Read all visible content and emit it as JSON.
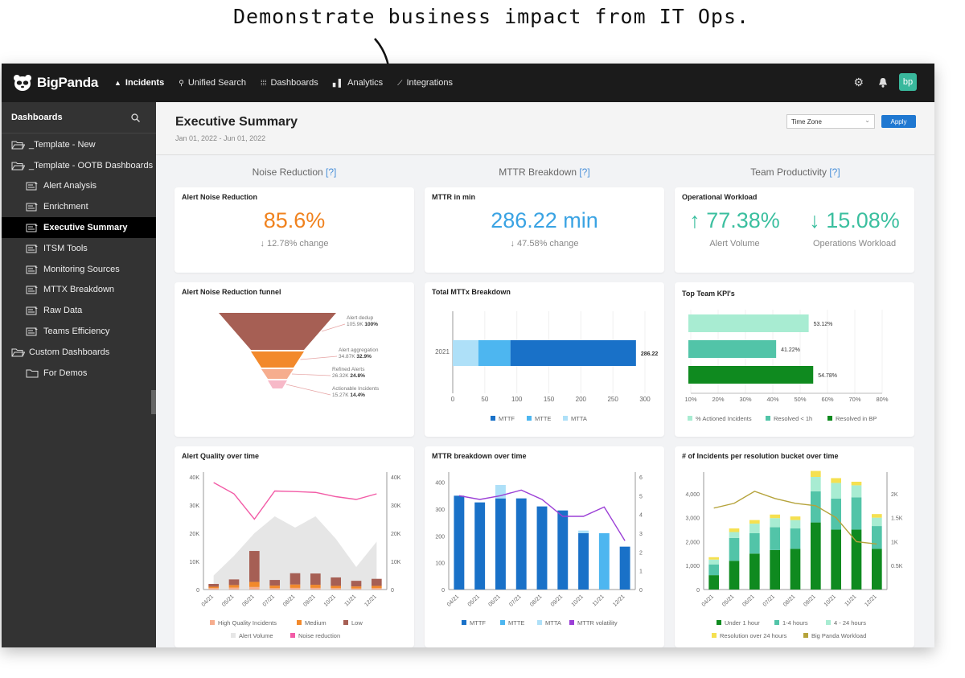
{
  "caption": "Demonstrate business impact from IT Ops.",
  "app": {
    "brand": "BigPanda",
    "nav": [
      {
        "label": "Incidents",
        "icon": "alert-triangle-icon",
        "active": true
      },
      {
        "label": "Unified Search",
        "icon": "search-icon",
        "active": false
      },
      {
        "label": "Dashboards",
        "icon": "grid-icon",
        "active": false
      },
      {
        "label": "Analytics",
        "icon": "bar-chart-icon",
        "active": false
      },
      {
        "label": "Integrations",
        "icon": "plug-icon",
        "active": false
      }
    ],
    "avatar": "bp"
  },
  "sidebar": {
    "title": "Dashboards",
    "items": [
      {
        "label": "_Template - New",
        "level": 0,
        "icon": "folder-open-icon"
      },
      {
        "label": "_Template - OOTB Dashboards",
        "level": 0,
        "icon": "folder-open-icon"
      },
      {
        "label": "Alert Analysis",
        "level": 1,
        "icon": "dashboard-icon"
      },
      {
        "label": "Enrichment",
        "level": 1,
        "icon": "dashboard-icon"
      },
      {
        "label": "Executive Summary",
        "level": 1,
        "icon": "dashboard-icon",
        "active": true
      },
      {
        "label": "ITSM Tools",
        "level": 1,
        "icon": "dashboard-icon"
      },
      {
        "label": "Monitoring Sources",
        "level": 1,
        "icon": "dashboard-icon"
      },
      {
        "label": "MTTX Breakdown",
        "level": 1,
        "icon": "dashboard-icon"
      },
      {
        "label": "Raw Data",
        "level": 1,
        "icon": "dashboard-icon"
      },
      {
        "label": "Teams Efficiency",
        "level": 1,
        "icon": "dashboard-icon"
      },
      {
        "label": "Custom Dashboards",
        "level": 0,
        "icon": "folder-open-icon"
      },
      {
        "label": "For Demos",
        "level": 1,
        "icon": "folder-icon"
      }
    ]
  },
  "page": {
    "title": "Executive Summary",
    "range": "Jan 01, 2022 - Jun 01, 2022",
    "timezone_placeholder": "Time Zone",
    "apply": "Apply"
  },
  "sections": [
    {
      "label": "Noise Reduction",
      "help": "[?]"
    },
    {
      "label": "MTTR Breakdown",
      "help": "[?]"
    },
    {
      "label": "Team Productivity",
      "help": "[?]"
    }
  ],
  "kpis": {
    "noise": {
      "title": "Alert Noise Reduction",
      "value": "85.6%",
      "change": "↓ 12.78% change",
      "color": "#f0821e"
    },
    "mttr": {
      "title": "MTTR in min",
      "value": "286.22 min",
      "change": "↓ 47.58% change",
      "color": "#3aa3e3"
    },
    "workload": {
      "title": "Operational Workload",
      "color": "#3bbf9f",
      "left": {
        "value": "↑ 77.38%",
        "label": "Alert Volume"
      },
      "right": {
        "value": "↓ 15.08%",
        "label": "Operations Workload"
      }
    }
  },
  "funnel": {
    "title": "Alert Noise Reduction funnel",
    "stages": [
      {
        "label": "Alert dedup",
        "value": "105.9K",
        "pct": "100%",
        "color": "#a65f54"
      },
      {
        "label": "Alert aggregation",
        "value": "34.87K",
        "pct": "32.9%",
        "color": "#f2892b"
      },
      {
        "label": "Refined Alerts",
        "value": "26.32K",
        "pct": "24.8%",
        "color": "#f6ad8e"
      },
      {
        "label": "Actionable Incidents",
        "value": "15.27K",
        "pct": "14.4%",
        "color": "#f7b9c8"
      }
    ]
  },
  "chart_data": [
    {
      "type": "bar",
      "title": "Total MTTx Breakdown",
      "orientation": "horizontal",
      "stacked": true,
      "categories": [
        "2021"
      ],
      "xlim": [
        0,
        300
      ],
      "xticks": [
        0,
        50,
        100,
        150,
        200,
        250,
        300
      ],
      "total_label": "286.22",
      "series": [
        {
          "name": "MTTA",
          "values": [
            40
          ],
          "color": "#aee0f8"
        },
        {
          "name": "MTTE",
          "values": [
            50
          ],
          "color": "#4db6f0"
        },
        {
          "name": "MTTF",
          "values": [
            196
          ],
          "color": "#1971c8"
        }
      ],
      "legend": [
        "MTTF",
        "MTTE",
        "MTTA"
      ],
      "legend_position": "bottom"
    },
    {
      "type": "bar",
      "title": "Top Team KPI's",
      "orientation": "horizontal",
      "xlim": [
        10,
        80
      ],
      "xticks": [
        "10%",
        "20%",
        "30%",
        "40%",
        "50%",
        "60%",
        "70%",
        "80%"
      ],
      "categories": [
        "% Actioned Incidents",
        "Resolved < 1h",
        "Resolved in BP"
      ],
      "values": [
        53.12,
        41.22,
        54.78
      ],
      "labels": [
        "53.12%",
        "41.22%",
        "54.78%"
      ],
      "colors": [
        "#a8ecd2",
        "#52c4a8",
        "#0f8a1f"
      ],
      "legend_position": "bottom"
    },
    {
      "type": "bar",
      "title": "Alert Quality over time",
      "x": [
        "04/21",
        "05/21",
        "06/21",
        "07/21",
        "08/21",
        "09/21",
        "10/21",
        "11/21",
        "12/21"
      ],
      "yticks": [
        "0",
        "10K",
        "20K",
        "30K",
        "40K"
      ],
      "ylim": [
        0,
        40000
      ],
      "series": [
        {
          "name": "High Quality Incidents",
          "kind": "bar",
          "values": [
            500,
            700,
            900,
            500,
            600,
            600,
            500,
            400,
            500
          ],
          "color": "#f6ad8e"
        },
        {
          "name": "Medium",
          "kind": "bar",
          "values": [
            500,
            900,
            1800,
            900,
            1200,
            1100,
            800,
            700,
            800
          ],
          "color": "#f2892b"
        },
        {
          "name": "Low",
          "kind": "bar",
          "values": [
            1000,
            2000,
            11000,
            2000,
            4000,
            4000,
            3000,
            2000,
            2500
          ],
          "color": "#a65f54"
        },
        {
          "name": "Alert Volume",
          "kind": "area",
          "values": [
            5000,
            12000,
            20000,
            26000,
            22000,
            26000,
            18000,
            8000,
            17000
          ],
          "color": "#e6e6e6"
        },
        {
          "name": "Noise reduction",
          "kind": "line",
          "values": [
            38000,
            34000,
            25000,
            35000,
            34800,
            34500,
            33000,
            32000,
            34000
          ],
          "color": "#f25ba6"
        }
      ],
      "legend_position": "bottom"
    },
    {
      "type": "bar",
      "title": "MTTR breakdown over time",
      "x": [
        "04/21",
        "05/21",
        "06/21",
        "07/21",
        "08/21",
        "09/21",
        "10/21",
        "11/21",
        "12/21"
      ],
      "yticks": [
        "0",
        "100",
        "200",
        "300",
        "400"
      ],
      "ylim": [
        0,
        420
      ],
      "y2ticks": [
        "0",
        "1",
        "2",
        "3",
        "4",
        "5",
        "6"
      ],
      "y2lim": [
        0,
        6
      ],
      "series": [
        {
          "name": "MTTF",
          "kind": "bar",
          "values": [
            350,
            325,
            340,
            340,
            310,
            295,
            210,
            0,
            160
          ],
          "color": "#1971c8"
        },
        {
          "name": "MTTE",
          "kind": "bar",
          "values": [
            0,
            0,
            0,
            0,
            0,
            0,
            0,
            210,
            0
          ],
          "color": "#4db6f0"
        },
        {
          "name": "MTTA",
          "kind": "bar",
          "values": [
            0,
            0,
            50,
            0,
            0,
            0,
            10,
            0,
            0
          ],
          "color": "#aee0f8"
        },
        {
          "name": "MTTR volatility",
          "kind": "line",
          "axis": "right",
          "values": [
            5,
            4.8,
            5,
            5.3,
            4.8,
            3.9,
            3.9,
            4.4,
            2.6
          ],
          "color": "#9b3fd6"
        }
      ],
      "legend_position": "bottom"
    },
    {
      "type": "bar",
      "title": "# of Incidents per resolution bucket over time",
      "x": [
        "04/21",
        "05/21",
        "06/21",
        "07/21",
        "08/21",
        "09/21",
        "10/21",
        "11/21",
        "12/21"
      ],
      "yticks": [
        "0",
        "1,000",
        "2,000",
        "3,000",
        "4,000"
      ],
      "ylim": [
        0,
        4700
      ],
      "y2ticks": [
        "0.5K",
        "1K",
        "1.5K",
        "2K"
      ],
      "y2lim": [
        0,
        2350
      ],
      "stacked": true,
      "series": [
        {
          "name": "Under 1 hour",
          "kind": "bar",
          "values": [
            600,
            1200,
            1500,
            1650,
            1700,
            2800,
            2500,
            2500,
            1700
          ],
          "color": "#0f8a1f"
        },
        {
          "name": "1-4 hours",
          "kind": "bar",
          "values": [
            450,
            950,
            850,
            950,
            850,
            1300,
            1300,
            1350,
            950
          ],
          "color": "#52c4a8"
        },
        {
          "name": "4 - 24 hours",
          "kind": "bar",
          "values": [
            200,
            250,
            400,
            380,
            350,
            600,
            650,
            500,
            350
          ],
          "color": "#a8ecd2"
        },
        {
          "name": "Resolution over 24 hours",
          "kind": "bar",
          "values": [
            100,
            150,
            150,
            150,
            150,
            250,
            200,
            150,
            150
          ],
          "color": "#f5e050"
        },
        {
          "name": "Big Panda Workload",
          "kind": "line",
          "axis": "right",
          "values": [
            1700,
            1800,
            2050,
            1900,
            1800,
            1750,
            1500,
            1000,
            950
          ],
          "color": "#b5a33b"
        }
      ],
      "legend_position": "bottom"
    }
  ]
}
